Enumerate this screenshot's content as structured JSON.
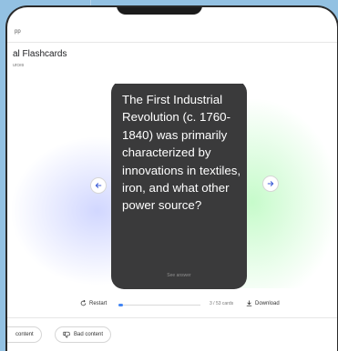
{
  "header": {
    "status_text": "",
    "breadcrumb": "pp",
    "title": "al Flashcards",
    "subtitle": "urces"
  },
  "card": {
    "question": "The First Industrial Revolution (c. 1760-1840) was primarily characterized by innovations in textiles, iron, and what other power source?",
    "see_answer_label": "See answer"
  },
  "navigation": {
    "prev_icon": "arrow-left-icon",
    "next_icon": "arrow-right-icon"
  },
  "controls": {
    "restart_label": "Restart",
    "progress_fraction": 0.05,
    "card_count": "3 / 53 cards",
    "download_label": "Download"
  },
  "feedback": {
    "good_label": "content",
    "bad_label": "Bad content"
  },
  "colors": {
    "accent": "#4285f4",
    "card_bg": "#3a3a3b",
    "glow_blue": "#8796ff",
    "glow_green": "#78f582",
    "backdrop": "#93c1e2"
  }
}
